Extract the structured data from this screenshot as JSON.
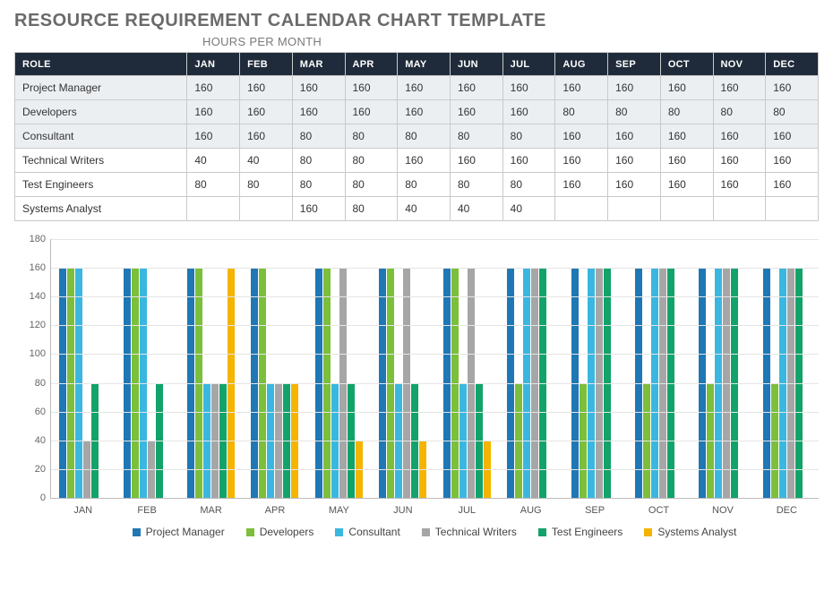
{
  "title": "RESOURCE REQUIREMENT CALENDAR CHART TEMPLATE",
  "subhead": "HOURS PER MONTH",
  "table": {
    "header_role": "ROLE",
    "months": [
      "JAN",
      "FEB",
      "MAR",
      "APR",
      "MAY",
      "JUN",
      "JUL",
      "AUG",
      "SEP",
      "OCT",
      "NOV",
      "DEC"
    ],
    "rows": [
      {
        "role": "Project Manager",
        "vals": [
          "160",
          "160",
          "160",
          "160",
          "160",
          "160",
          "160",
          "160",
          "160",
          "160",
          "160",
          "160"
        ],
        "shade": true
      },
      {
        "role": "Developers",
        "vals": [
          "160",
          "160",
          "160",
          "160",
          "160",
          "160",
          "160",
          "80",
          "80",
          "80",
          "80",
          "80"
        ],
        "shade": true
      },
      {
        "role": "Consultant",
        "vals": [
          "160",
          "160",
          "80",
          "80",
          "80",
          "80",
          "80",
          "160",
          "160",
          "160",
          "160",
          "160"
        ],
        "shade": true
      },
      {
        "role": "Technical Writers",
        "vals": [
          "40",
          "40",
          "80",
          "80",
          "160",
          "160",
          "160",
          "160",
          "160",
          "160",
          "160",
          "160"
        ],
        "shade": false
      },
      {
        "role": "Test Engineers",
        "vals": [
          "80",
          "80",
          "80",
          "80",
          "80",
          "80",
          "80",
          "160",
          "160",
          "160",
          "160",
          "160"
        ],
        "shade": false
      },
      {
        "role": "Systems Analyst",
        "vals": [
          "",
          "",
          "160",
          "80",
          "40",
          "40",
          "40",
          "",
          "",
          "",
          "",
          ""
        ],
        "shade": false
      }
    ]
  },
  "colors": {
    "Project Manager": "#1f77b4",
    "Developers": "#7bbf3a",
    "Consultant": "#3ab7e0",
    "Technical Writers": "#a6a6a6",
    "Test Engineers": "#12a36a",
    "Systems Analyst": "#f4b400"
  },
  "chart_data": {
    "type": "bar",
    "title": "",
    "xlabel": "",
    "ylabel": "",
    "ylim": [
      0,
      180
    ],
    "yticks": [
      0,
      20,
      40,
      60,
      80,
      100,
      120,
      140,
      160,
      180
    ],
    "categories": [
      "JAN",
      "FEB",
      "MAR",
      "APR",
      "MAY",
      "JUN",
      "JUL",
      "AUG",
      "SEP",
      "OCT",
      "NOV",
      "DEC"
    ],
    "series": [
      {
        "name": "Project Manager",
        "values": [
          160,
          160,
          160,
          160,
          160,
          160,
          160,
          160,
          160,
          160,
          160,
          160
        ]
      },
      {
        "name": "Developers",
        "values": [
          160,
          160,
          160,
          160,
          160,
          160,
          160,
          80,
          80,
          80,
          80,
          80
        ]
      },
      {
        "name": "Consultant",
        "values": [
          160,
          160,
          80,
          80,
          80,
          80,
          80,
          160,
          160,
          160,
          160,
          160
        ]
      },
      {
        "name": "Technical Writers",
        "values": [
          40,
          40,
          80,
          80,
          160,
          160,
          160,
          160,
          160,
          160,
          160,
          160
        ]
      },
      {
        "name": "Test Engineers",
        "values": [
          80,
          80,
          80,
          80,
          80,
          80,
          80,
          160,
          160,
          160,
          160,
          160
        ]
      },
      {
        "name": "Systems Analyst",
        "values": [
          null,
          null,
          160,
          80,
          40,
          40,
          40,
          null,
          null,
          null,
          null,
          null
        ]
      }
    ]
  }
}
